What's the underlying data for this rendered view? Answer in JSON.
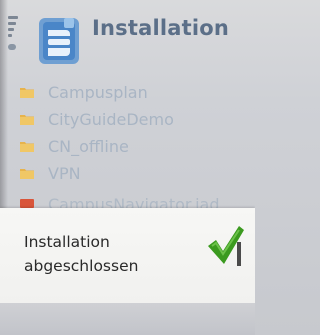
{
  "header": {
    "title": "Installation",
    "app_icon": "installation-app-icon",
    "signal_icon": "signal-strength-icon"
  },
  "list": {
    "items": [
      {
        "label": "Campusplan",
        "icon": "folder-icon",
        "icon_color": "#e8b34a"
      },
      {
        "label": "CityGuideDemo",
        "icon": "folder-icon",
        "icon_color": "#e8b34a"
      },
      {
        "label": "CN_offline",
        "icon": "folder-icon",
        "icon_color": "#e8b34a"
      },
      {
        "label": "VPN",
        "icon": "folder-icon",
        "icon_color": "#e8b34a"
      }
    ],
    "partial_item": {
      "label": "CampusNavigator.jad",
      "icon": "java-file-icon",
      "icon_color": "#d9553a"
    }
  },
  "notification": {
    "line1": "Installation",
    "line2": "abgeschlossen",
    "icon": "checkmark-icon",
    "icon_color": "#3b9a1f"
  }
}
